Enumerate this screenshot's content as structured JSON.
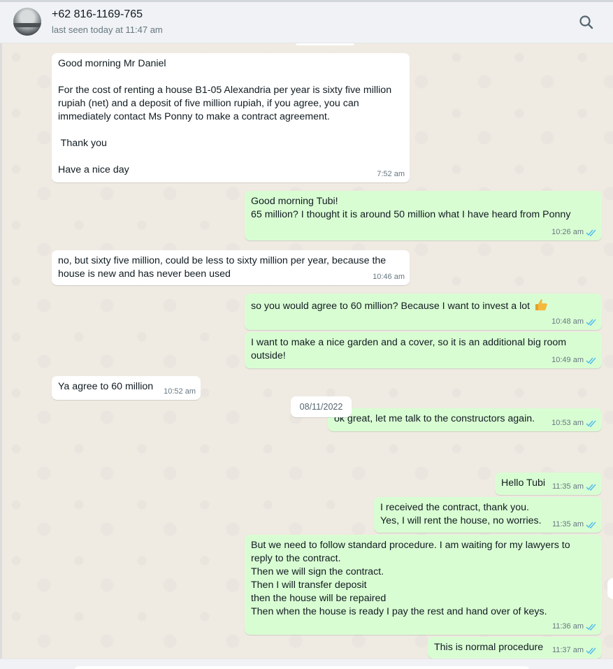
{
  "header": {
    "contact_name": "+62 816-1169-765",
    "contact_status": "last seen today at 11:47 am"
  },
  "colors": {
    "incoming_bubble": "#ffffff",
    "outgoing_bubble": "#d9fdd3",
    "chat_background": "#efeae2",
    "read_ticks": "#53bdeb"
  },
  "messages": [
    {
      "direction": "in",
      "text": "Good morning Mr Daniel\n\nFor the cost of renting a house B1-05 Alexandria per year is sixty five million\nrupiah (net) and a deposit of five million rupiah, if you agree, you can\nimmediately contact Ms Ponny to make a contract agreement.\n\n Thank you\n\nHave a nice day",
      "time": "7:52 am"
    },
    {
      "direction": "out",
      "text": "Good morning Tubi!\n65 million? I thought it is around 50 million what I have heard from Ponny",
      "time": "10:26 am",
      "status": "read"
    },
    {
      "direction": "in",
      "text": "no, but sixty five million, could be less to sixty million per year, because the\nhouse is new and has never been used",
      "time": "10:46 am"
    },
    {
      "direction": "out",
      "text": "so you would agree to 60 million? Because I want to invest a lot",
      "emoji": "thumbs-up-emoji",
      "time": "10:48 am",
      "status": "read"
    },
    {
      "direction": "out",
      "text": "I want to make a nice garden and a cover, so it is an additional big room\noutside!",
      "time": "10:49 am",
      "status": "read"
    },
    {
      "direction": "in",
      "text": "Ya agree to 60 million",
      "time": "10:52 am"
    },
    {
      "direction": "out",
      "text": "ok great, let me talk to the constructors again.",
      "time": "10:53 am",
      "status": "read"
    },
    {
      "direction": "out",
      "text": "Hello Tubi",
      "time": "11:35 am",
      "status": "read"
    },
    {
      "direction": "out",
      "text": "I received the contract, thank you.\nYes, I will rent the house, no worries.",
      "time": "11:35 am",
      "status": "read"
    },
    {
      "direction": "out",
      "text": "But we need to follow standard procedure. I am waiting for my lawyers to\nreply to the contract.\nThen we will sign the contract.\nThen I will transfer deposit\nthen the house will be repaired\nThen when the house is ready I pay the rest and hand over of keys.",
      "time": "11:36 am",
      "status": "read"
    },
    {
      "direction": "out",
      "text": "This is normal procedure",
      "time": "11:37 am",
      "status": "read"
    }
  ],
  "date_separator": "08/11/2022",
  "icons": {
    "search": "search-icon",
    "avatar": "avatar",
    "read": "double-check-icon"
  }
}
